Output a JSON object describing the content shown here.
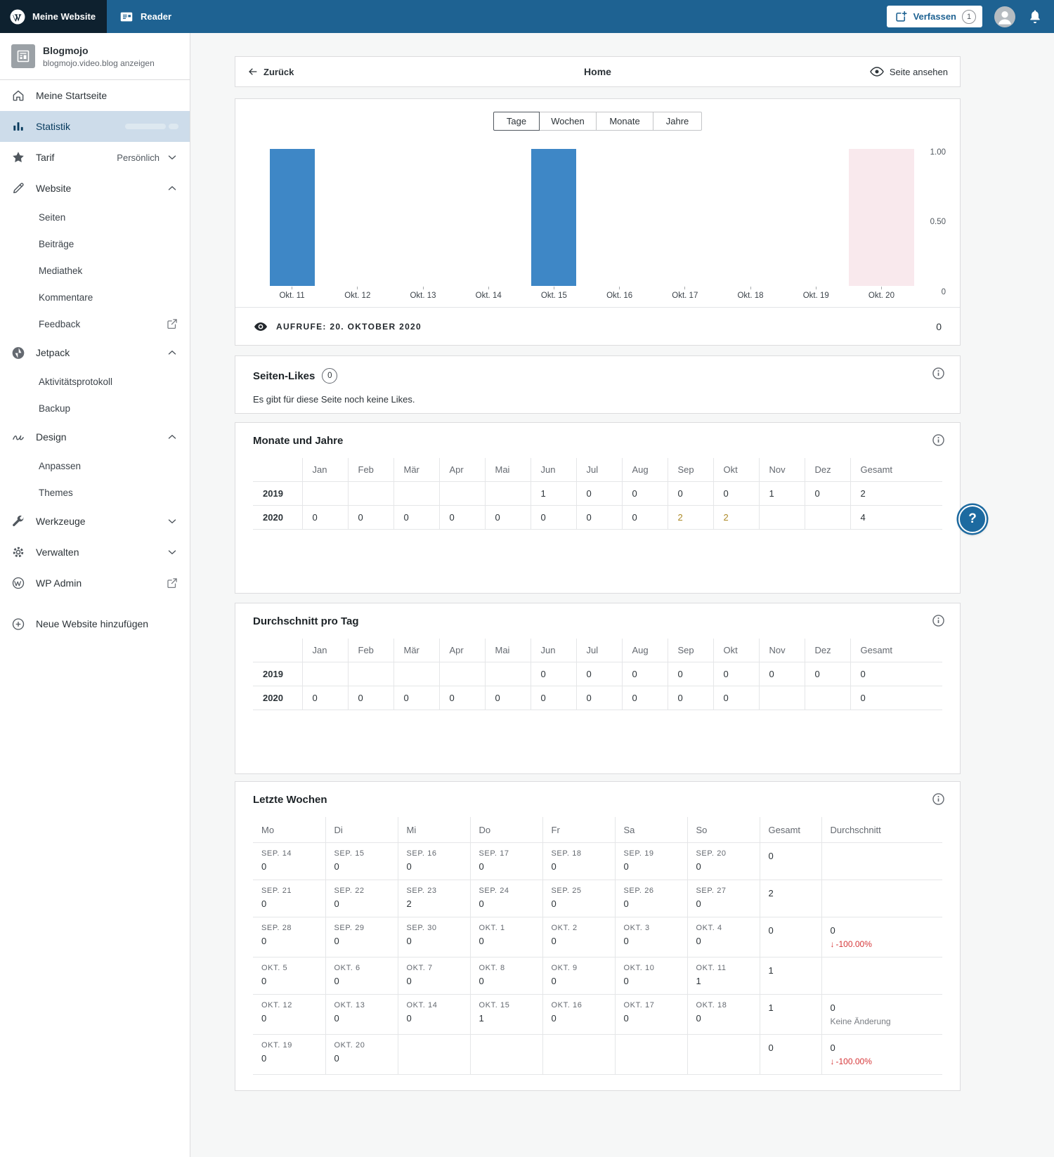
{
  "masthead": {
    "site_label": "Meine Website",
    "reader_label": "Reader",
    "compose_label": "Verfassen",
    "compose_badge": "1"
  },
  "sidebar": {
    "site_name": "Blogmojo",
    "site_subtitle": "blogmojo.video.blog anzeigen",
    "add_site_label": "Neue Website hinzufügen",
    "items": [
      {
        "label": "Meine Startseite",
        "icon": "home-icon",
        "level": "top"
      },
      {
        "label": "Statistik",
        "icon": "stats-icon",
        "level": "top",
        "selected": true,
        "skeleton": true
      },
      {
        "label": "Tarif",
        "icon": "star-icon",
        "level": "top",
        "right_label": "Persönlich",
        "chevron": "down"
      },
      {
        "label": "Website",
        "icon": "pencil-icon",
        "level": "top",
        "chevron": "up"
      },
      {
        "label": "Seiten",
        "level": "sub"
      },
      {
        "label": "Beiträge",
        "level": "sub"
      },
      {
        "label": "Mediathek",
        "level": "sub"
      },
      {
        "label": "Kommentare",
        "level": "sub"
      },
      {
        "label": "Feedback",
        "level": "sub",
        "external": true
      },
      {
        "label": "Jetpack",
        "icon": "jetpack-icon",
        "level": "top",
        "chevron": "up"
      },
      {
        "label": "Aktivitätsprotokoll",
        "level": "sub"
      },
      {
        "label": "Backup",
        "level": "sub"
      },
      {
        "label": "Design",
        "icon": "squiggle-icon",
        "level": "top",
        "chevron": "up"
      },
      {
        "label": "Anpassen",
        "level": "sub"
      },
      {
        "label": "Themes",
        "level": "sub"
      },
      {
        "label": "Werkzeuge",
        "icon": "wrench-icon",
        "level": "top",
        "chevron": "down"
      },
      {
        "label": "Verwalten",
        "icon": "gear-icon",
        "level": "top",
        "chevron": "down"
      },
      {
        "label": "WP Admin",
        "icon": "wordpress-icon",
        "level": "top",
        "external": true
      }
    ]
  },
  "header": {
    "back_label": "Zurück",
    "title": "Home",
    "view_label": "Seite ansehen"
  },
  "chart_card": {
    "tabs": [
      "Tage",
      "Wochen",
      "Monate",
      "Jahre"
    ],
    "selected_tab": "Tage",
    "footer_label": "AUFRUFE: 20. OKTOBER 2020",
    "footer_value": "0"
  },
  "chart_data": {
    "type": "bar",
    "title": "AUFRUFE: 20. OKTOBER 2020",
    "categories": [
      "Okt. 11",
      "Okt. 12",
      "Okt. 13",
      "Okt. 14",
      "Okt. 15",
      "Okt. 16",
      "Okt. 17",
      "Okt. 18",
      "Okt. 19",
      "Okt. 20"
    ],
    "values": [
      1,
      0,
      0,
      0,
      1,
      0,
      0,
      0,
      0,
      0
    ],
    "highlighted_category": "Okt. 20",
    "highlighted_index": 9,
    "ylim": [
      0,
      1
    ],
    "yticks": [
      "1.00",
      "0.50",
      "0"
    ],
    "grid": false,
    "legend": "none",
    "bar_color": "#3e87c6",
    "highlight_color": "#f9e9ed"
  },
  "likes_card": {
    "title": "Seiten-Likes",
    "badge": "0",
    "empty_text": "Es gibt für diese Seite noch keine Likes."
  },
  "months_card": {
    "title": "Monate und Jahre",
    "columns": [
      "Jan",
      "Feb",
      "Mär",
      "Apr",
      "Mai",
      "Jun",
      "Jul",
      "Aug",
      "Sep",
      "Okt",
      "Nov",
      "Dez",
      "Gesamt"
    ],
    "rows": [
      {
        "year": "2019",
        "values": [
          "",
          "",
          "",
          "",
          "",
          "1",
          "0",
          "0",
          "0",
          "0",
          "1",
          "0"
        ],
        "highlights": [],
        "total": "2"
      },
      {
        "year": "2020",
        "values": [
          "0",
          "0",
          "0",
          "0",
          "0",
          "0",
          "0",
          "0",
          "2",
          "2",
          "",
          ""
        ],
        "highlights": [
          8,
          9
        ],
        "total": "4"
      }
    ]
  },
  "avg_card": {
    "title": "Durchschnitt pro Tag",
    "columns": [
      "Jan",
      "Feb",
      "Mär",
      "Apr",
      "Mai",
      "Jun",
      "Jul",
      "Aug",
      "Sep",
      "Okt",
      "Nov",
      "Dez",
      "Gesamt"
    ],
    "rows": [
      {
        "year": "2019",
        "values": [
          "",
          "",
          "",
          "",
          "",
          "0",
          "0",
          "0",
          "0",
          "0",
          "0",
          "0"
        ],
        "highlights": [],
        "total": "0"
      },
      {
        "year": "2020",
        "values": [
          "0",
          "0",
          "0",
          "0",
          "0",
          "0",
          "0",
          "0",
          "0",
          "0",
          "",
          ""
        ],
        "highlights": [],
        "total": "0"
      }
    ]
  },
  "weeks_card": {
    "title": "Letzte Wochen",
    "columns": [
      "Mo",
      "Di",
      "Mi",
      "Do",
      "Fr",
      "Sa",
      "So",
      "Gesamt",
      "Durchschnitt"
    ],
    "rows": [
      {
        "days": [
          {
            "date": "SEP. 14",
            "value": "0"
          },
          {
            "date": "SEP. 15",
            "value": "0"
          },
          {
            "date": "SEP. 16",
            "value": "0"
          },
          {
            "date": "SEP. 17",
            "value": "0"
          },
          {
            "date": "SEP. 18",
            "value": "0"
          },
          {
            "date": "SEP. 19",
            "value": "0"
          },
          {
            "date": "SEP. 20",
            "value": "0"
          }
        ],
        "total": "0",
        "avg": null
      },
      {
        "days": [
          {
            "date": "SEP. 21",
            "value": "0"
          },
          {
            "date": "SEP. 22",
            "value": "0"
          },
          {
            "date": "SEP. 23",
            "value": "2",
            "highlight": true
          },
          {
            "date": "SEP. 24",
            "value": "0"
          },
          {
            "date": "SEP. 25",
            "value": "0"
          },
          {
            "date": "SEP. 26",
            "value": "0"
          },
          {
            "date": "SEP. 27",
            "value": "0"
          }
        ],
        "total": "2",
        "avg": null
      },
      {
        "days": [
          {
            "date": "SEP. 28",
            "value": "0"
          },
          {
            "date": "SEP. 29",
            "value": "0"
          },
          {
            "date": "SEP. 30",
            "value": "0"
          },
          {
            "date": "OKT. 1",
            "value": "0"
          },
          {
            "date": "OKT. 2",
            "value": "0"
          },
          {
            "date": "OKT. 3",
            "value": "0"
          },
          {
            "date": "OKT. 4",
            "value": "0"
          }
        ],
        "total": "0",
        "avg": {
          "value": "0",
          "delta": "-100.00%",
          "direction": "down"
        }
      },
      {
        "days": [
          {
            "date": "OKT. 5",
            "value": "0"
          },
          {
            "date": "OKT. 6",
            "value": "0"
          },
          {
            "date": "OKT. 7",
            "value": "0"
          },
          {
            "date": "OKT. 8",
            "value": "0"
          },
          {
            "date": "OKT. 9",
            "value": "0"
          },
          {
            "date": "OKT. 10",
            "value": "0"
          },
          {
            "date": "OKT. 11",
            "value": "1"
          }
        ],
        "total": "1",
        "avg": null
      },
      {
        "days": [
          {
            "date": "OKT. 12",
            "value": "0"
          },
          {
            "date": "OKT. 13",
            "value": "0"
          },
          {
            "date": "OKT. 14",
            "value": "0"
          },
          {
            "date": "OKT. 15",
            "value": "1"
          },
          {
            "date": "OKT. 16",
            "value": "0"
          },
          {
            "date": "OKT. 17",
            "value": "0"
          },
          {
            "date": "OKT. 18",
            "value": "0"
          }
        ],
        "total": "1",
        "avg": {
          "value": "0",
          "note": "Keine Änderung"
        }
      },
      {
        "days": [
          {
            "date": "OKT. 19",
            "value": "0"
          },
          {
            "date": "OKT. 20",
            "value": "0"
          },
          null,
          null,
          null,
          null,
          null
        ],
        "total": "0",
        "avg": {
          "value": "0",
          "delta": "-100.00%",
          "direction": "down"
        }
      }
    ]
  },
  "help_button": {
    "label": "?"
  },
  "colors": {
    "masthead_blue": "#1e6292",
    "masthead_dark": "#0e212f",
    "bar_blue": "#3e87c6",
    "highlight_pink": "#f9e9ed",
    "value_gold": "#ad8a27",
    "negative_red": "#d63638",
    "selected_item_bg": "#cddcea"
  }
}
